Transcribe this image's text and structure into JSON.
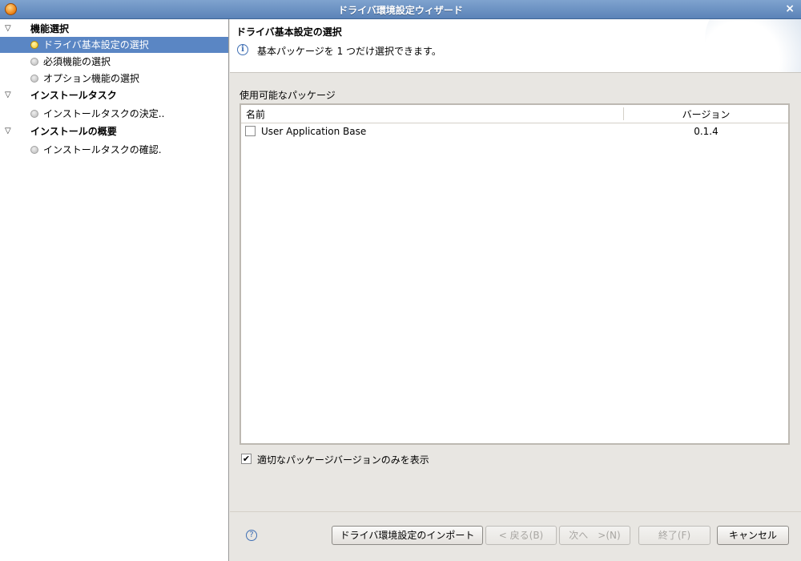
{
  "window": {
    "title": "ドライバ環境設定ウィザード",
    "close_glyph": "×",
    "app_icon": "app-icon"
  },
  "sidebar": {
    "groups": [
      {
        "label": "機能選択",
        "items": [
          {
            "label": "ドライバ基本設定の選択",
            "selected": true
          },
          {
            "label": "必須機能の選択",
            "selected": false
          },
          {
            "label": "オプション機能の選択",
            "selected": false
          }
        ]
      },
      {
        "label": "インストールタスク",
        "items": [
          {
            "label": "インストールタスクの決定..",
            "selected": false
          }
        ]
      },
      {
        "label": "インストールの概要",
        "items": [
          {
            "label": "インストールタスクの確認.",
            "selected": false
          }
        ]
      }
    ],
    "expand_glyph": "▽"
  },
  "header": {
    "title": "ドライバ基本設定の選択",
    "message": "基本パッケージを 1 つだけ選択できます。",
    "info_glyph": "i"
  },
  "packages": {
    "label": "使用可能なパッケージ",
    "columns": [
      "名前",
      "バージョン"
    ],
    "rows": [
      {
        "name": "User Application Base",
        "version": "0.1.4",
        "checked": false
      }
    ]
  },
  "filter": {
    "label": "適切なパッケージバージョンのみを表示",
    "checked": true,
    "check_glyph": "✔"
  },
  "buttons": {
    "help_glyph": "?",
    "import": "ドライバ環境設定のインポート",
    "back": "< 戻る(B)",
    "next": "次へ　>(N)",
    "finish": "終了(F)",
    "cancel": "キャンセル"
  },
  "colors": {
    "titlebar": "#5b83b8",
    "selection": "#5a86c4",
    "info_blue": "#3f6fb4"
  }
}
